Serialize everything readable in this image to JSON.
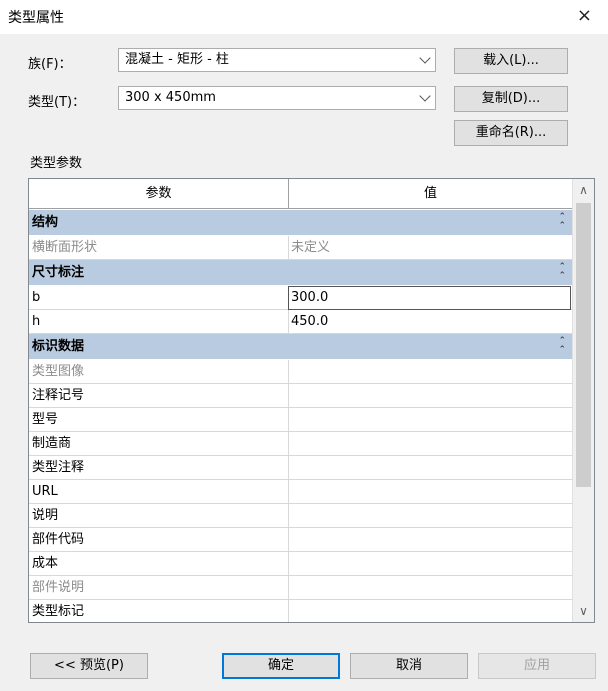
{
  "window": {
    "title": "类型属性",
    "close_glyph": "×"
  },
  "family": {
    "label": "族(F)：",
    "value": "混凝土 - 矩形 - 柱"
  },
  "type": {
    "label": "类型(T)：",
    "value": "300 x 450mm"
  },
  "buttons": {
    "load": "载入(L)...",
    "duplicate": "复制(D)...",
    "rename": "重命名(R)...",
    "preview": "<< 预览(P)",
    "ok": "确定",
    "cancel": "取消",
    "apply": "应用"
  },
  "params_label": "类型参数",
  "grid": {
    "col_param": "参数",
    "col_value": "值",
    "groups": [
      {
        "name": "结构",
        "rows": [
          {
            "param": "横断面形状",
            "value": "未定义",
            "disabled": true
          }
        ]
      },
      {
        "name": "尺寸标注",
        "rows": [
          {
            "param": "b",
            "value": "300.0",
            "editing": true
          },
          {
            "param": "h",
            "value": "450.0"
          }
        ]
      },
      {
        "name": "标识数据",
        "rows": [
          {
            "param": "类型图像",
            "value": "",
            "disabled": true
          },
          {
            "param": "注释记号",
            "value": ""
          },
          {
            "param": "型号",
            "value": ""
          },
          {
            "param": "制造商",
            "value": ""
          },
          {
            "param": "类型注释",
            "value": ""
          },
          {
            "param": "URL",
            "value": ""
          },
          {
            "param": "说明",
            "value": ""
          },
          {
            "param": "部件代码",
            "value": ""
          },
          {
            "param": "成本",
            "value": ""
          },
          {
            "param": "部件说明",
            "value": "",
            "disabled": true
          },
          {
            "param": "类型标记",
            "value": ""
          }
        ]
      }
    ]
  },
  "scroll": {
    "position": 0.0,
    "visible_fraction": 0.72
  }
}
